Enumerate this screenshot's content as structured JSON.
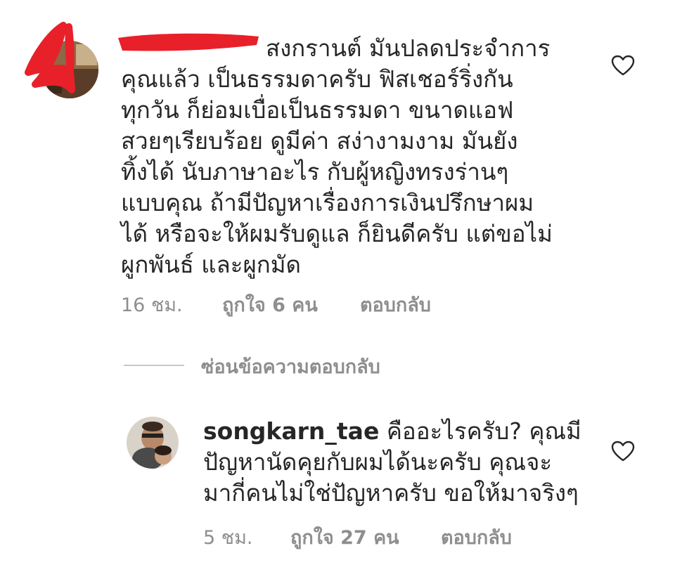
{
  "comments": [
    {
      "username": "",
      "text_lines": [
        "สงกรานต์ มันปลดประจำการ",
        "คุณแล้ว เป็นธรรมดาครับ ฟิสเชอร์ริ่งกัน",
        "ทุกวัน ก็ย่อมเบื่อเป็นธรรมดา ขนาดแอฟ",
        "สวยๆเรียบร้อย ดูมีค่า สง่างามงาม มันยัง",
        "ทิ้งได้ นับภาษาอะไร กับผู้หญิงทรงร่านๆ",
        "แบบคุณ ถ้ามีปัญหาเรื่องการเงินปรึกษาผม",
        "ได้ หรือจะให้ผมรับดูแล ก็ยินดีครับ แต่ขอไม่",
        "ผูกพันธ์ และผูกมัด"
      ],
      "time": "16 ชม.",
      "likes": "ถูกใจ 6 คน",
      "reply": "ตอบกลับ"
    },
    {
      "username": "songkarn_tae",
      "text_lines": [
        "คืออะไรครับ? คุณมี",
        "ปัญหานัดคุยกับผมได้นะครับ คุณจะ",
        "มากี่คนไม่ใช่ปัญหาครับ ขอให้มาจริงๆ"
      ],
      "time": "5 ชม.",
      "likes": "ถูกใจ 27 คน",
      "reply": "ตอบกลับ"
    }
  ],
  "view_replies": {
    "label": "ซ่อนข้อความตอบกลับ"
  },
  "colors": {
    "text": "#262626",
    "muted": "#8e8e8e",
    "divider": "#c7c7c7",
    "redaction": "#e8202a"
  },
  "icons": {
    "like": "heart-outline-icon"
  }
}
